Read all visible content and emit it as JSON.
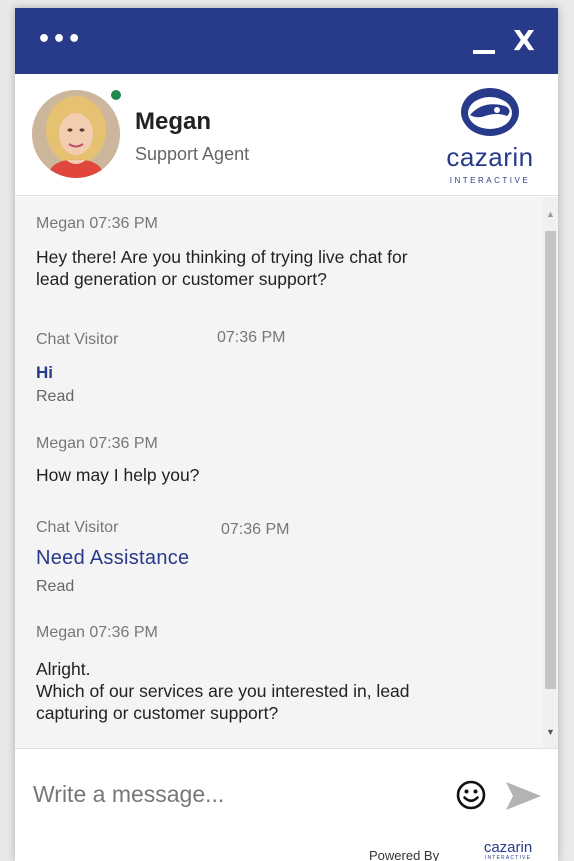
{
  "window": {
    "menu_label": "•••",
    "close_label": "X",
    "accent_color": "#283a8a"
  },
  "agent": {
    "name": "Megan",
    "role": "Support Agent",
    "status": "online",
    "status_color": "#1f8a4c"
  },
  "brand": {
    "name": "cazarin",
    "subtitle": "INTERACTIVE"
  },
  "messages": [
    {
      "sender": "Megan",
      "time": "07:36 PM",
      "lines": [
        "Hey there! Are you thinking of trying live chat for",
        "lead generation or customer support?"
      ]
    },
    {
      "sender": "Chat Visitor",
      "time": "07:36 PM",
      "text": "Hi",
      "status": "Read"
    },
    {
      "sender": "Megan",
      "time": "07:36 PM",
      "lines": [
        "How may I help you?"
      ]
    },
    {
      "sender": "Chat Visitor",
      "time": "07:36 PM",
      "text": "Need Assistance",
      "status": "Read"
    },
    {
      "sender": "Megan",
      "time": "07:36 PM",
      "lines": [
        "Alright.",
        "Which of our services are you interested in, lead",
        "capturing or customer support?"
      ]
    }
  ],
  "composer": {
    "placeholder": "Write a message...",
    "emoji_icon": "smiley-icon",
    "send_icon": "send-arrow-icon"
  },
  "footer": {
    "powered_by": "Powered By",
    "logo_name": "cazarin",
    "logo_sub": "INTERACTIVE"
  }
}
